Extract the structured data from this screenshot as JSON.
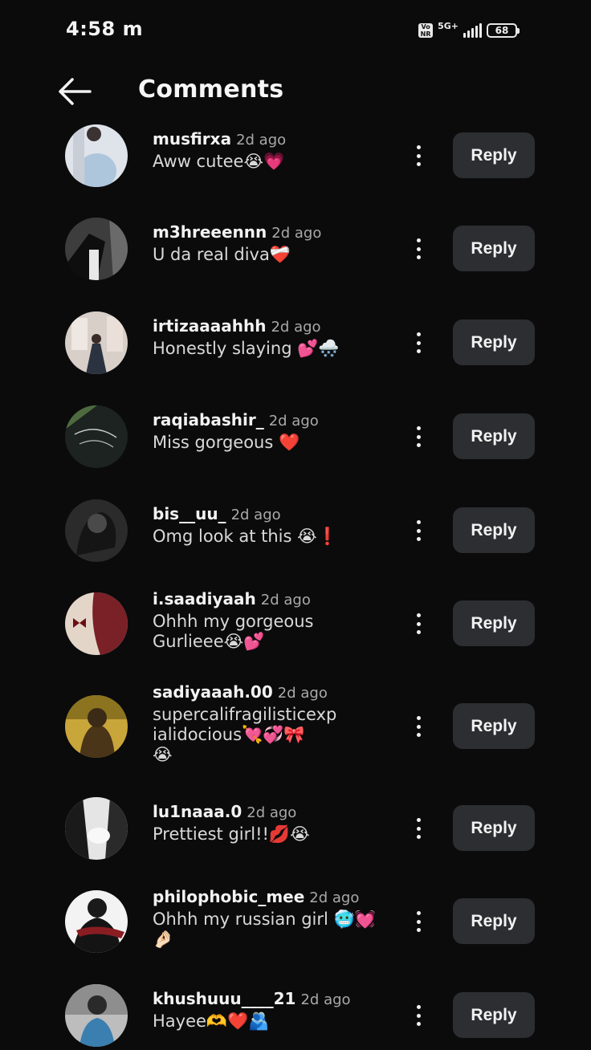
{
  "status": {
    "time": "4:58",
    "carrier_glyph": "m",
    "volte": "Vo\nNR",
    "network": "5G+",
    "battery": "68"
  },
  "header": {
    "title": "Comments"
  },
  "comments": [
    {
      "user": "musfirxa",
      "time": "2d ago",
      "text": "Aww cutee😭💗",
      "reply": "Reply"
    },
    {
      "user": "m3hreeennn",
      "time": "2d ago",
      "text": "U da real diva❤️‍🩹",
      "reply": "Reply"
    },
    {
      "user": "irtizaaaahhh",
      "time": "2d ago",
      "text": "Honestly slaying 💕🌨️",
      "reply": "Reply"
    },
    {
      "user": "raqiabashir_",
      "time": "2d ago",
      "text": "Miss gorgeous ❤️",
      "reply": "Reply"
    },
    {
      "user": "bis__uu_",
      "time": "2d ago",
      "text": "Omg look at this 😭❗",
      "reply": "Reply"
    },
    {
      "user": "i.saadiyaah",
      "time": "2d ago",
      "text": "Ohhh my gorgeous\nGurlieee😭💕",
      "reply": "Reply"
    },
    {
      "user": "sadiyaaah.00",
      "time": "2d ago",
      "text": "supercalifragilisticexp\nialidocious💘💞🎀\n😭",
      "reply": "Reply"
    },
    {
      "user": "lu1naaa.0",
      "time": "2d ago",
      "text": "Prettiest girl!!💋😭",
      "reply": "Reply"
    },
    {
      "user": "philophobic_mee",
      "time": "2d ago",
      "text": "Ohhh my russian girl 🥶💓\n🤌🏻",
      "reply": "Reply"
    },
    {
      "user": "khushuuu____21",
      "time": "2d ago",
      "text": "Hayee🫶❤️🫂",
      "reply": "Reply"
    }
  ]
}
